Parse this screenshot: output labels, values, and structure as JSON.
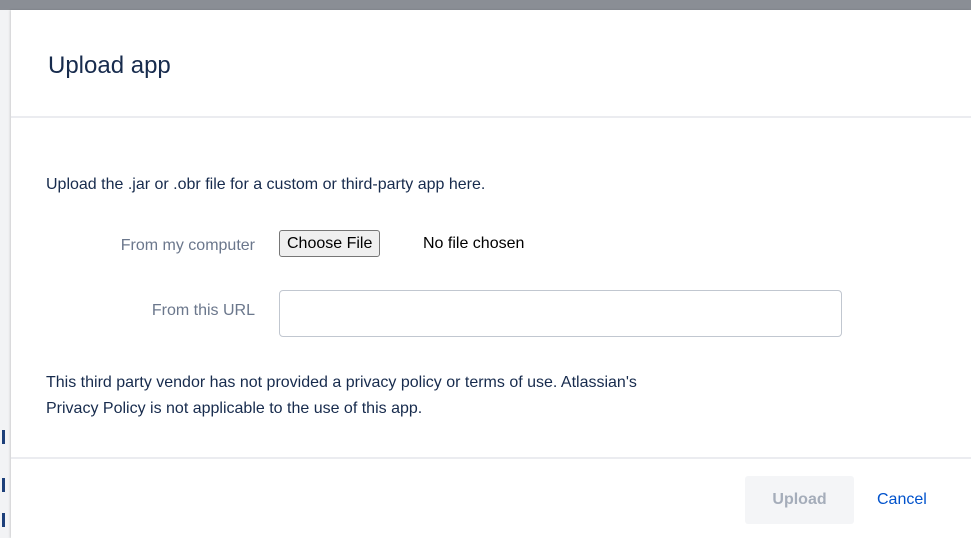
{
  "dialog": {
    "title": "Upload app",
    "intro": "Upload the .jar or .obr file for a custom or third-party app here."
  },
  "form": {
    "computer_label": "From my computer",
    "choose_file_label": "Choose File",
    "file_status": "No file chosen",
    "url_label": "From this URL",
    "url_value": ""
  },
  "notice": {
    "line1": "This third party vendor has not provided a privacy policy or terms of use. Atlassian's",
    "line2": "Privacy Policy is not applicable to the use of this app."
  },
  "footer": {
    "upload_label": "Upload",
    "upload_enabled": false,
    "cancel_label": "Cancel"
  },
  "colors": {
    "title_text": "#172b4d",
    "label_text": "#6b778c",
    "link": "#0052cc",
    "disabled_button_bg": "#f4f5f7",
    "disabled_button_text": "#a5adba",
    "backdrop": "#8a8e95"
  }
}
